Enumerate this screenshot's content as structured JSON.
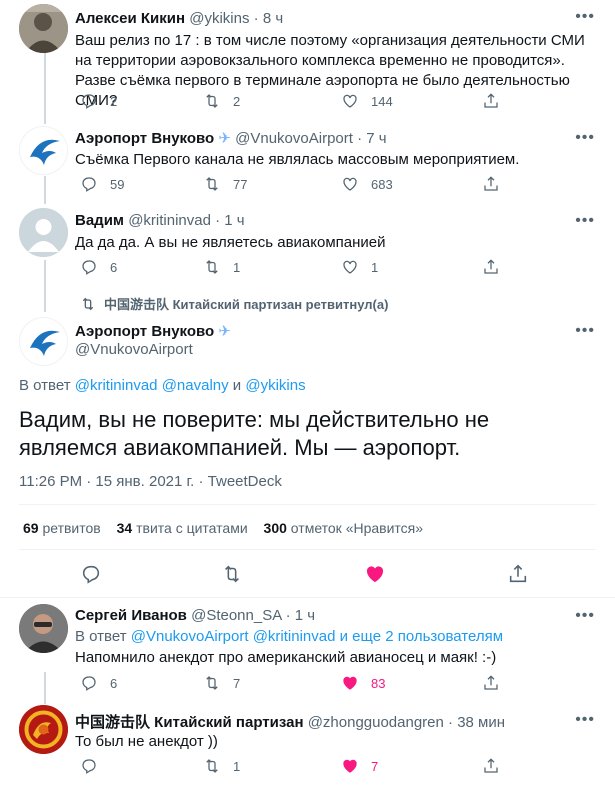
{
  "tweets": [
    {
      "name": "Алексеи Кикин",
      "handle": "@ykikins",
      "time": "8 ч",
      "text": "Ваш релиз по 17 : в том числе поэтому «организация деятельности СМИ на территории аэровокзального комплекса временно не проводится». Разве съёмка первого в терминале аэропорта не было  деятельностью СМИ?",
      "replies": "2",
      "retweets": "2",
      "likes": "144"
    },
    {
      "name": "Аэропорт Внуково",
      "handle": "@VnukovoAirport",
      "time": "7 ч",
      "text": "Съёмка Первого канала не являлась массовым мероприятием.",
      "replies": "59",
      "retweets": "77",
      "likes": "683"
    },
    {
      "name": "Вадим",
      "handle": "@kritininvad",
      "time": "1 ч",
      "text": "Да да да. А вы не являетесь авиакомпанией",
      "replies": "6",
      "retweets": "1",
      "likes": "1"
    }
  ],
  "retweet_context": "中国游击队 Китайский партизан ретвитнул(а)",
  "main_tweet": {
    "name": "Аэропорт Внуково",
    "handle": "@VnukovoAirport",
    "reply_prefix": "В ответ",
    "mention1": "@kritininvad",
    "mention2": "@navalny",
    "and": "и",
    "mention3": "@ykikins",
    "text": "Вадим, вы не поверите: мы действительно не являемся авиакомпанией. Мы — аэропорт.",
    "timestamp": "11:26 PM · 15 янв. 2021 г. · TweetDeck",
    "stats": {
      "retweets_count": "69",
      "retweets_label": "ретвитов",
      "quotes_count": "34",
      "quotes_label": "твита с цитатами",
      "likes_count": "300",
      "likes_label": "отметок «Нравится»"
    }
  },
  "replies": [
    {
      "name": "Сергей Иванов",
      "handle": "@Steonn_SA",
      "time": "1 ч",
      "reply_prefix": "В ответ",
      "reply_to": "@VnukovoAirport @kritininvad",
      "reply_more": "и еще 2 пользователям",
      "text": "Напомнило анекдот про американский авианосец и маяк! :-)",
      "replies": "6",
      "retweets": "7",
      "likes": "83"
    },
    {
      "name": "中国游击队 Китайский партизан",
      "handle": "@zhongguodangren",
      "time": "38 мин",
      "text": "То был не анекдот ))",
      "replies": "",
      "retweets": "1",
      "likes": "7"
    }
  ],
  "colors": {
    "accent": "#1d9bf0",
    "like_active": "#f91880",
    "secondary_text": "#536471"
  }
}
